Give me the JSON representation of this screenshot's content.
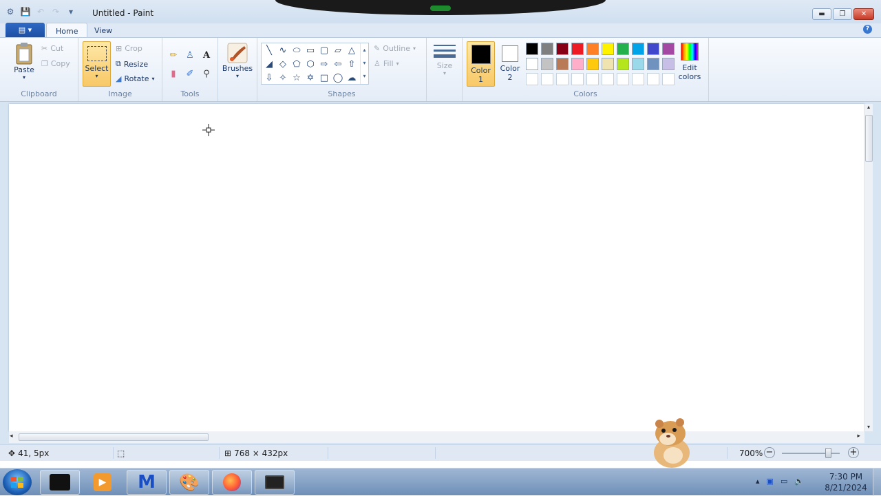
{
  "window": {
    "title": "Untitled - Paint"
  },
  "menu": {
    "file_label": "▤ ▾",
    "tabs": [
      "Home",
      "View"
    ]
  },
  "ribbon": {
    "clipboard": {
      "group": "Clipboard",
      "paste": "Paste",
      "cut": "Cut",
      "copy": "Copy"
    },
    "image": {
      "group": "Image",
      "select": "Select",
      "crop": "Crop",
      "resize": "Resize",
      "rotate": "Rotate"
    },
    "tools": {
      "group": "Tools"
    },
    "brushes": {
      "label": "Brushes"
    },
    "shapes": {
      "group": "Shapes",
      "outline": "Outline",
      "fill": "Fill"
    },
    "size": {
      "label": "Size"
    },
    "colors": {
      "group": "Colors",
      "color1_label": "Color",
      "color1_num": "1",
      "color2_label": "Color",
      "color2_num": "2",
      "color1_value": "#000000",
      "color2_value": "#ffffff",
      "edit_label": "Edit",
      "edit_label2": "colors",
      "palette": [
        "#000000",
        "#7f7f7f",
        "#880015",
        "#ed1c24",
        "#ff7f27",
        "#fff200",
        "#22b14c",
        "#00a2e8",
        "#3f48cc",
        "#a349a4",
        "#ffffff",
        "#c3c3c3",
        "#b97a57",
        "#ffaec9",
        "#ffc90e",
        "#efe4b0",
        "#b5e61d",
        "#99d9ea",
        "#7092be",
        "#c8bfe7",
        "#ffffff",
        "#ffffff",
        "#ffffff",
        "#ffffff",
        "#ffffff",
        "#ffffff",
        "#ffffff",
        "#ffffff",
        "#ffffff",
        "#ffffff"
      ]
    }
  },
  "status": {
    "cursor_pos": "41, 5px",
    "canvas_size": "768 × 432px",
    "zoom": "700%",
    "zoom_fraction": 0.8
  },
  "taskbar": {
    "time": "7:30 PM",
    "date": "8/21/2024"
  }
}
